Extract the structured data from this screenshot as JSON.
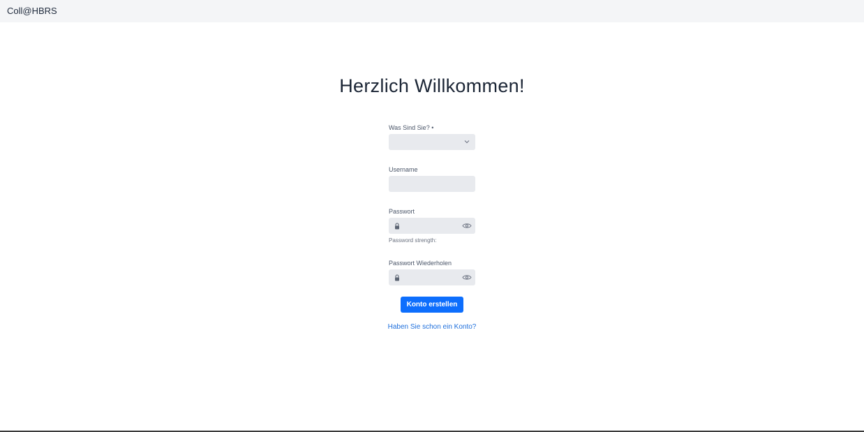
{
  "header": {
    "brand": "Coll@HBRS"
  },
  "main": {
    "title": "Herzlich Willkommen!",
    "fields": {
      "role": {
        "label": "Was Sind Sie? •",
        "value": ""
      },
      "username": {
        "label": "Username",
        "value": ""
      },
      "password": {
        "label": "Passwort",
        "value": "",
        "strength_label": "Password strength:"
      },
      "password_repeat": {
        "label": "Passwort Wiederholen",
        "value": ""
      }
    },
    "submit_label": "Konto erstellen",
    "login_link": "Haben Sie schon ein Konto?"
  },
  "colors": {
    "primary_button": "#0d6efd",
    "link": "#1e6fdc",
    "input_background": "#e8eaee",
    "header_background": "#f4f5f7"
  },
  "icons": [
    "chevron-down-icon",
    "lock-icon",
    "eye-icon"
  ]
}
